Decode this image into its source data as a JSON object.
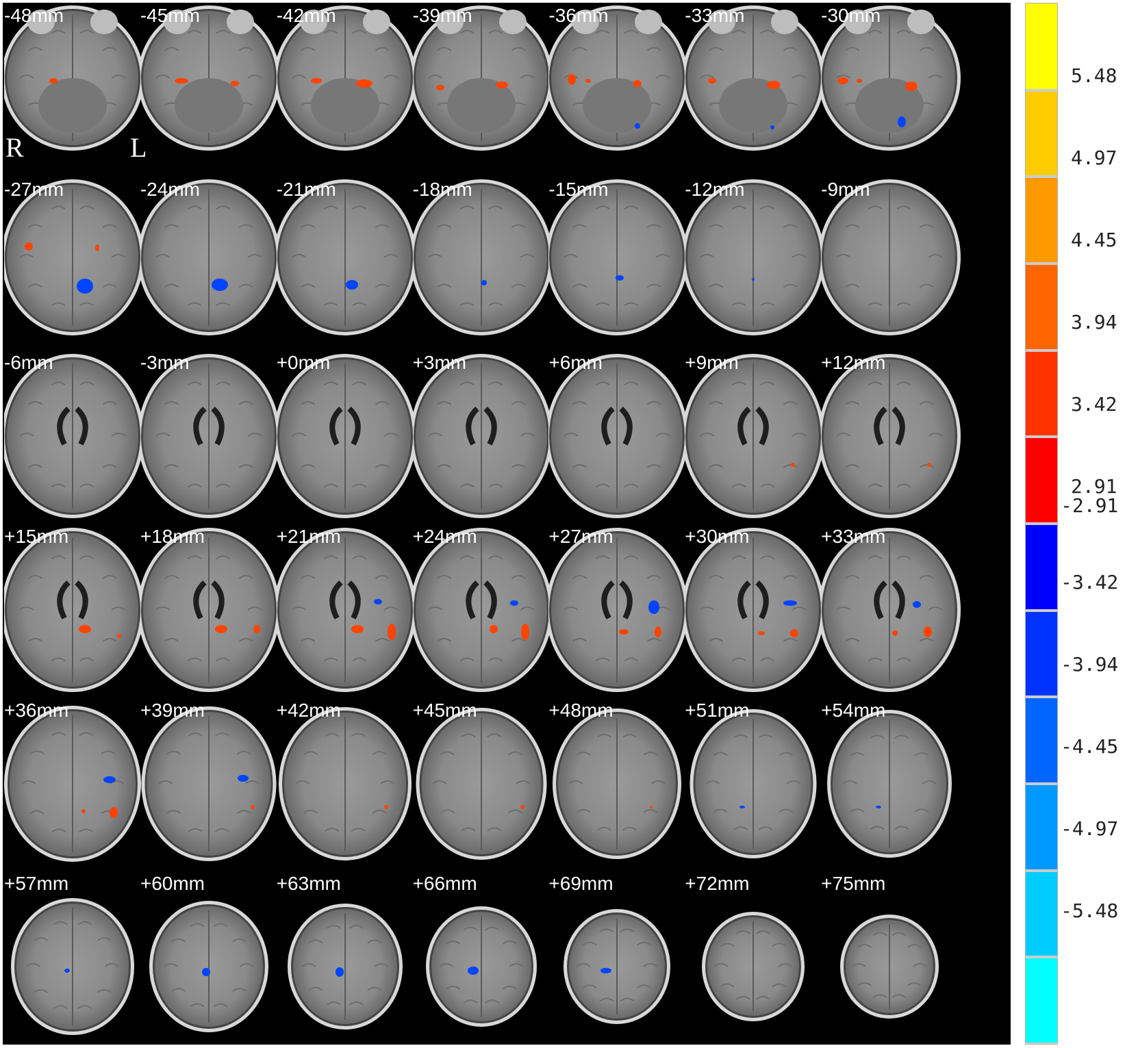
{
  "orientation": {
    "right": "R",
    "left": "L"
  },
  "slices": [
    "-48mm",
    "-45mm",
    "-42mm",
    "-39mm",
    "-36mm",
    "-33mm",
    "-30mm",
    "-27mm",
    "-24mm",
    "-21mm",
    "-18mm",
    "-15mm",
    "-12mm",
    "-9mm",
    "-6mm",
    "-3mm",
    "+0mm",
    "+3mm",
    "+6mm",
    "+9mm",
    "+12mm",
    "+15mm",
    "+18mm",
    "+21mm",
    "+24mm",
    "+27mm",
    "+30mm",
    "+33mm",
    "+36mm",
    "+39mm",
    "+42mm",
    "+45mm",
    "+48mm",
    "+51mm",
    "+54mm",
    "+57mm",
    "+60mm",
    "+63mm",
    "+66mm",
    "+69mm",
    "+72mm",
    "+75mm"
  ],
  "colorbar": {
    "ticks": [
      "5.48",
      "4.97",
      "4.45",
      "3.94",
      "3.42",
      "2.91",
      "-2.91",
      "-3.42",
      "-3.94",
      "-4.45",
      "-4.97",
      "-5.48"
    ],
    "colors": [
      "#ffff00",
      "#ffcc00",
      "#ff9900",
      "#ff6600",
      "#ff3300",
      "#ff0000",
      "#0000ff",
      "#0033ff",
      "#0066ff",
      "#0099ff",
      "#00ccff",
      "#00ffff"
    ]
  },
  "colors": {
    "positive": "#ff4400",
    "negative": "#0044ff",
    "background": "#000000"
  }
}
